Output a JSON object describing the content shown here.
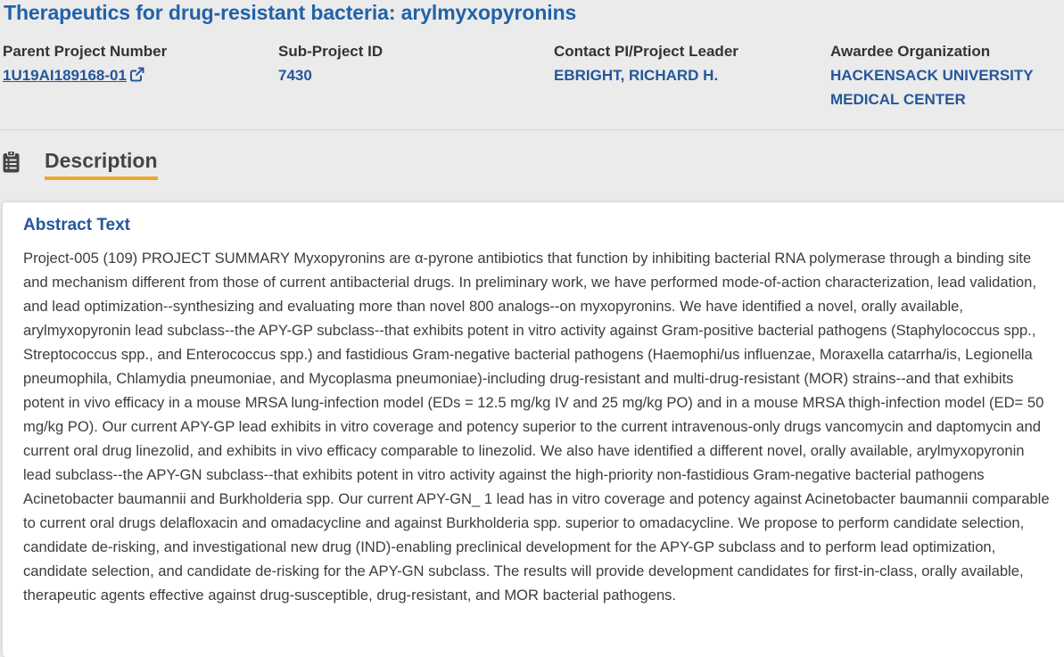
{
  "title": "Therapeutics for drug-resistant bacteria: arylmyxopyronins",
  "meta": {
    "parent_project": {
      "label": "Parent Project Number",
      "value": "1U19AI189168-01"
    },
    "sub_project": {
      "label": "Sub-Project ID",
      "value": "7430"
    },
    "contact_pi": {
      "label": "Contact PI/Project Leader",
      "value": "EBRIGHT, RICHARD H."
    },
    "awardee": {
      "label": "Awardee Organization",
      "line1": "HACKENSACK UNIVERSITY",
      "line2": "MEDICAL CENTER"
    }
  },
  "description": {
    "heading": "Description",
    "icon": "clipboard-icon"
  },
  "abstract": {
    "heading": "Abstract Text",
    "text": "Project-005 (109) PROJECT SUMMARY Myxopyronins are α-pyrone antibiotics that function by inhibiting bacterial RNA polymerase through a binding site and mechanism different from those of current antibacterial drugs. In preliminary work, we have performed mode-of-action characterization, lead validation, and lead optimization--synthesizing and evaluating more than novel 800 analogs--on myxopyronins. We have identified a novel, orally available, arylmyxopyronin lead subclass--the APY-GP subclass--that exhibits potent in vitro activity against Gram-positive bacterial pathogens (Staphylococcus spp., Streptococcus spp., and Enterococcus spp.) and fastidious Gram-negative bacterial pathogens (Haemophi/us influenzae, Moraxella catarrha/is, Legionella pneumophila, Chlamydia pneumoniae, and Mycoplasma pneumoniae)-including drug-resistant and multi-drug-resistant (MOR) strains--and that exhibits potent in vivo efficacy in a mouse MRSA lung-infection model (EDs = 12.5 mg/kg IV and 25 mg/kg PO) and in a mouse MRSA thigh-infection model (ED= 50 mg/kg PO). Our current APY-GP lead exhibits in vitro coverage and potency superior to the current intravenous-only drugs vancomycin and daptomycin and current oral drug linezolid, and exhibits in vivo efficacy comparable to linezolid. We also have identified a different novel, orally available, arylmyxopyronin lead subclass--the APY-GN subclass--that exhibits potent in vitro activity against the high-priority non-fastidious Gram-negative bacterial pathogens Acinetobacter baumannii and Burkholderia spp. Our current APY-GN_ 1 lead has in vitro coverage and potency against Acinetobacter baumannii comparable to current oral drugs delafloxacin and omadacycline and against Burkholderia spp. superior to omadacycline. We propose to perform candidate selection, candidate de-risking, and investigational new drug (IND)-enabling preclinical development for the APY-GP subclass and to perform lead optimization, candidate selection, and candidate de-risking for the APY-GN subclass. The results will provide development candidates for first-in-class, orally available, therapeutic agents effective against drug-susceptible, drug-resistant, and MOR bacterial pathogens."
  },
  "colors": {
    "title": "#2162a8",
    "value_link": "#24579a",
    "accent_underline": "#f0a52a",
    "background": "#ebebeb",
    "card": "#ffffff"
  }
}
